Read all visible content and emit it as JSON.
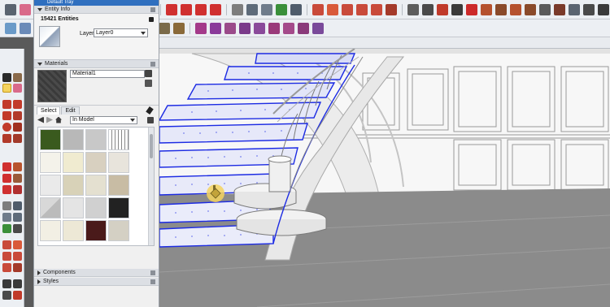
{
  "tray": {
    "title": "Default Tray",
    "entity_info": {
      "header": "Entity Info",
      "count": "15421 Entities",
      "layer_label": "Layer:",
      "layer_value": "Layer0"
    },
    "materials": {
      "header": "Materials",
      "material_name": "Material1",
      "tabs": [
        "Select",
        "Edit"
      ],
      "collection_value": "In Model"
    },
    "components": {
      "header": "Components"
    },
    "styles": {
      "header": "Styles"
    }
  },
  "colors": {
    "toolbar_bg": "#eceff3",
    "panel_bg": "#f0f0f0",
    "selection_blue": "#1c2be3",
    "highlight_yellow": "#f4d35e",
    "floor_grey": "#8b8b8b"
  },
  "icons": [
    "select-arrow-icon",
    "eraser-icon",
    "paint-bucket-icon",
    "pencil-icon",
    "arc-icon",
    "rectangle-icon",
    "circle-icon",
    "push-pull-icon",
    "move-icon",
    "rotate-icon",
    "scale-icon",
    "offset-icon",
    "tape-measure-icon",
    "text-icon",
    "protractor-icon",
    "orbit-icon",
    "pan-icon",
    "zoom-icon",
    "zoom-extents-icon",
    "walk-icon",
    "lock-icon",
    "eyedropper-icon",
    "home-icon",
    "back-arrow-icon",
    "forward-arrow-icon"
  ]
}
